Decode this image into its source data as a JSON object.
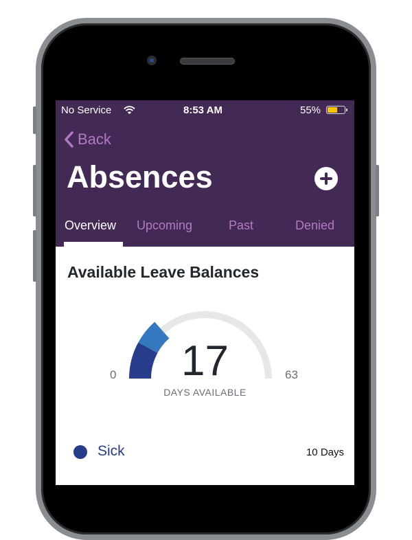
{
  "status_bar": {
    "carrier": "No Service",
    "time": "8:53 AM",
    "battery": "55%",
    "battery_level": 0.55,
    "wifi_icon": "wifi-icon"
  },
  "nav": {
    "back_label": "Back",
    "title": "Absences",
    "add_icon": "plus-circle-icon"
  },
  "tabs": [
    {
      "label": "Overview",
      "active": true
    },
    {
      "label": "Upcoming"
    },
    {
      "label": "Past"
    },
    {
      "label": "Denied"
    }
  ],
  "colors": {
    "header": "#422a55",
    "accent": "#b37ac4",
    "sick": "#283c8c",
    "second": "#3478c0",
    "track": "#e6e7e9"
  },
  "balances": {
    "title": "Available Leave Balances",
    "available": "17",
    "available_label": "DAYS AVAILABLE",
    "min": "0",
    "max": "63",
    "segments": [
      {
        "name": "Sick",
        "days": 10,
        "color": "#283c8c"
      },
      {
        "days": 7,
        "color": "#3478c0"
      }
    ],
    "legend": [
      {
        "name": "Sick",
        "value": "10 Days",
        "color": "#283c8c"
      }
    ]
  }
}
